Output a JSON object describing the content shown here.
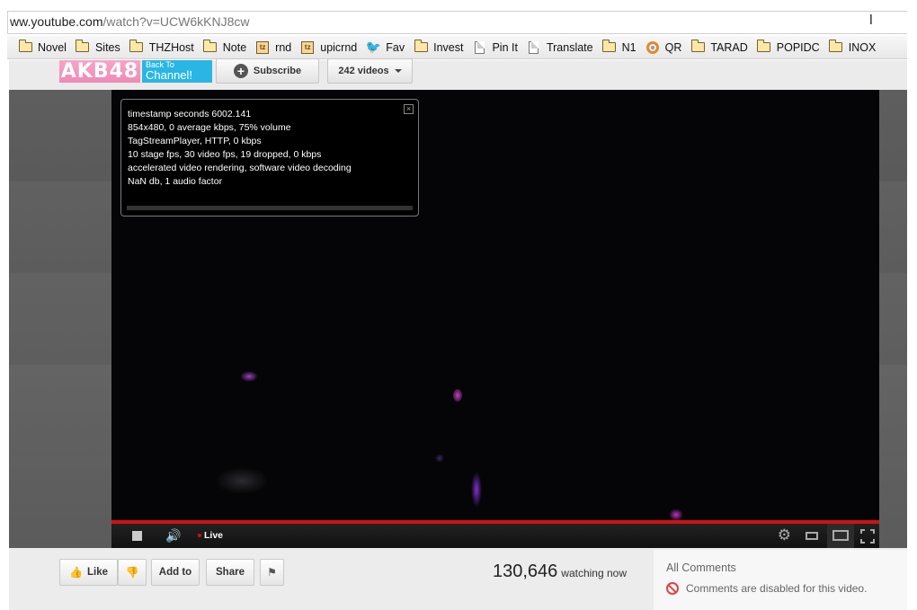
{
  "browser": {
    "url_host": "ww.youtube.com",
    "url_path": "/watch?v=UCW6kKNJ8cw",
    "bookmarks": [
      {
        "label": "Novel",
        "icon": "folder-icon"
      },
      {
        "label": "Sites",
        "icon": "folder-icon"
      },
      {
        "label": "THZHost",
        "icon": "folder-icon"
      },
      {
        "label": "Note",
        "icon": "folder-icon"
      },
      {
        "label": "rnd",
        "icon": "tz-icon"
      },
      {
        "label": "upicrnd",
        "icon": "tz-icon"
      },
      {
        "label": "Fav",
        "icon": "twitter-bird-icon"
      },
      {
        "label": "Invest",
        "icon": "folder-icon"
      },
      {
        "label": "Pin It",
        "icon": "page-icon"
      },
      {
        "label": "Translate",
        "icon": "page-icon"
      },
      {
        "label": "N1",
        "icon": "folder-icon"
      },
      {
        "label": "QR",
        "icon": "qr-ring-icon"
      },
      {
        "label": "TARAD",
        "icon": "folder-icon"
      },
      {
        "label": "POPIDC",
        "icon": "folder-icon"
      },
      {
        "label": "INOX",
        "icon": "folder-icon"
      }
    ]
  },
  "channel": {
    "logo_text": "AKB48",
    "back_to_line1": "Back To",
    "back_to_line2": "Channel!",
    "subscribe_label": "Subscribe",
    "videos_label": "242 videos"
  },
  "player": {
    "stats": [
      "timestamp seconds 6002.141",
      "854x480, 0 average kbps, 75% volume",
      "TagStreamPlayer, HTTP, 0 kbps",
      "10 stage fps, 30 video fps, 19 dropped, 0 kbps",
      "accelerated video rendering, software video decoding",
      "NaN db, 1 audio factor"
    ],
    "stats_close": "×",
    "live_label": "Live",
    "progress": 1.0
  },
  "actions": {
    "like_label": "Like",
    "add_to_label": "Add to",
    "share_label": "Share"
  },
  "viewers": {
    "count": "130,646",
    "label": "watching now"
  },
  "comments": {
    "title": "All Comments",
    "disabled_text": "Comments are disabled for this video."
  },
  "colors": {
    "accent_red": "#d21111",
    "logo_pink": "#f089b5",
    "back_channel_blue": "#29b6e5"
  }
}
